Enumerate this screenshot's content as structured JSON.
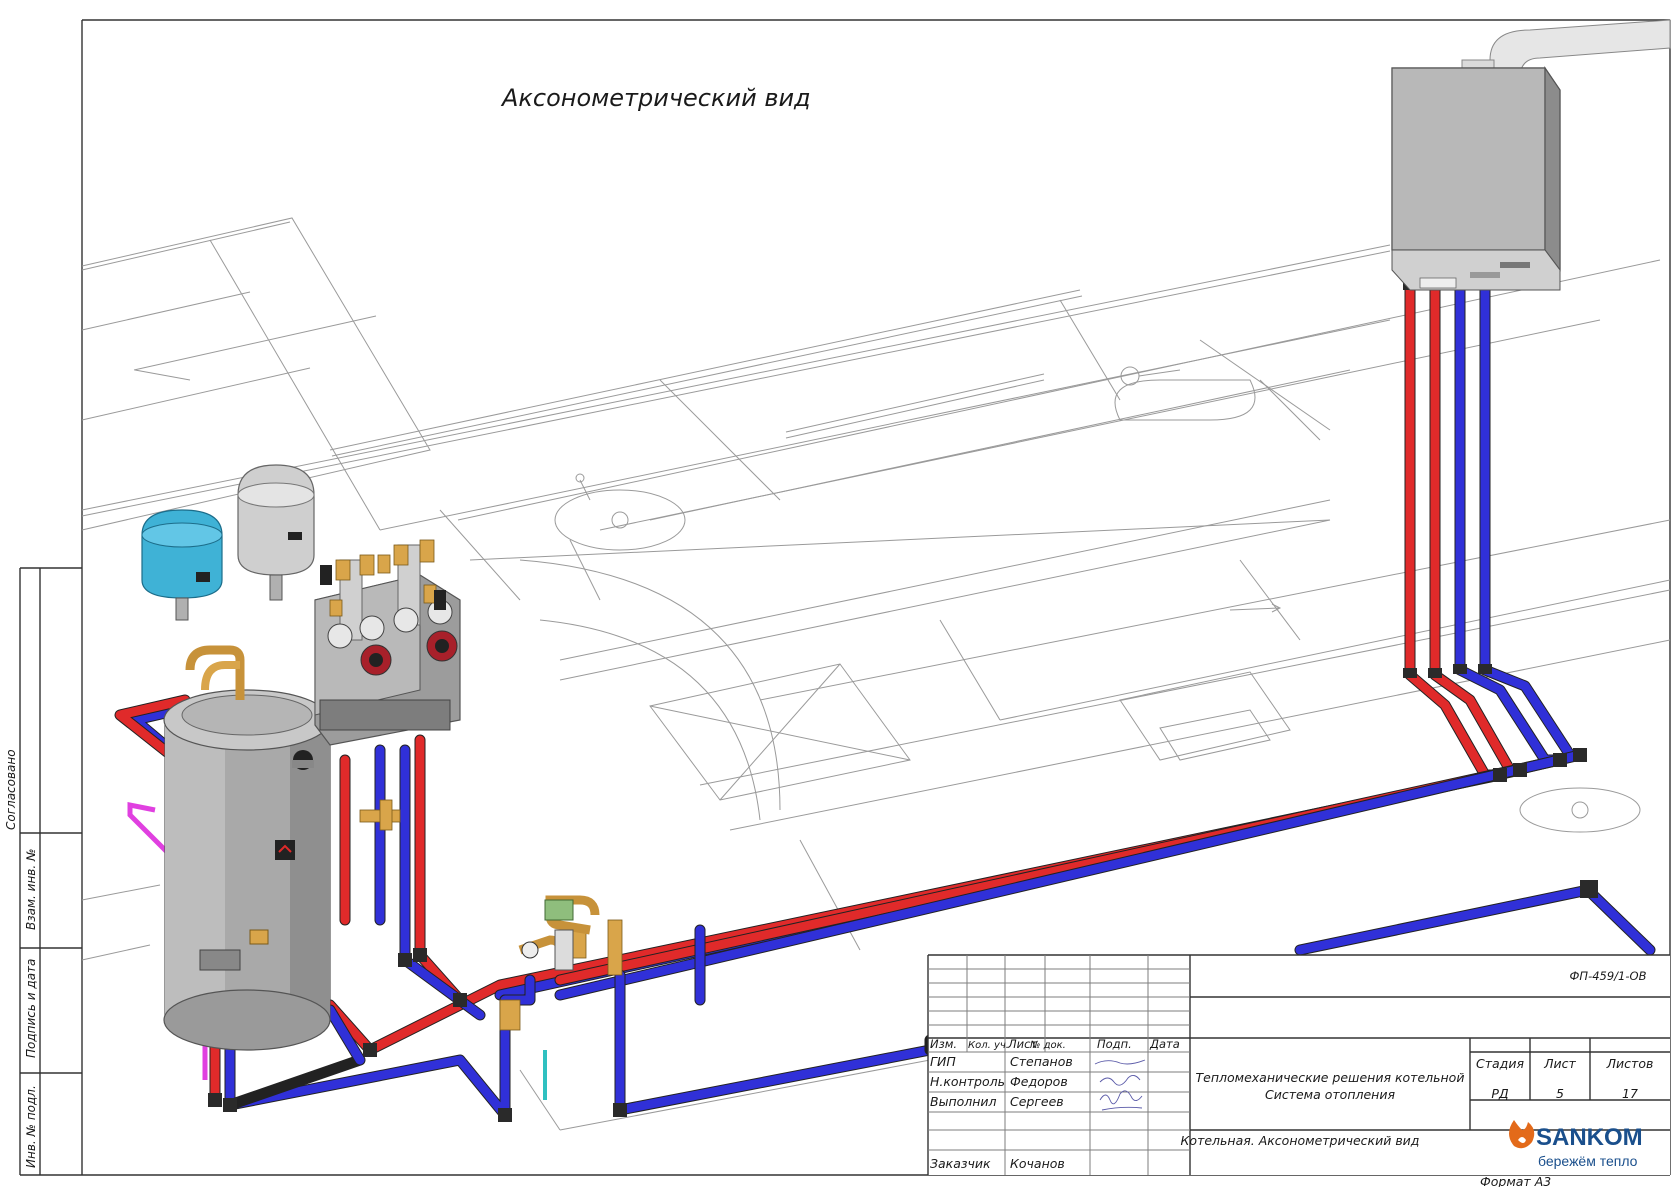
{
  "title": "Аксонометрический вид",
  "drawing_code": "ФП-459/1-ОВ",
  "side_labels": [
    "Согласовано",
    "Взам. инв. №",
    "Подпись и дата",
    "Инв. № подл."
  ],
  "title_block": {
    "columns": [
      "Изм.",
      "Кол. уч.",
      "Лист",
      "№ док.",
      "Подп.",
      "Дата"
    ],
    "people": [
      {
        "role": "ГИП",
        "name": "Степанов"
      },
      {
        "role": "Н.контроль",
        "name": "Федоров"
      },
      {
        "role": "Выполнил",
        "name": "Сергеев"
      },
      {
        "role": "Заказчик",
        "name": "Кочанов"
      }
    ],
    "project": [
      "Тепломеханические решения котельной",
      "Система отопления"
    ],
    "sheet_title": "Котельная. Аксонометрический вид",
    "stage_header": "Стадия",
    "sheet_header": "Лист",
    "sheets_header": "Листов",
    "stage": "РД",
    "sheet": "5",
    "sheets": "17"
  },
  "brand": {
    "name": "SANKOM",
    "slogan": "бережём тепло",
    "color": "#1a4f8c",
    "accent": "#e36a1a"
  },
  "format": "Формат А3",
  "colors": {
    "supply": "#e02a2a",
    "return": "#3030d8"
  }
}
